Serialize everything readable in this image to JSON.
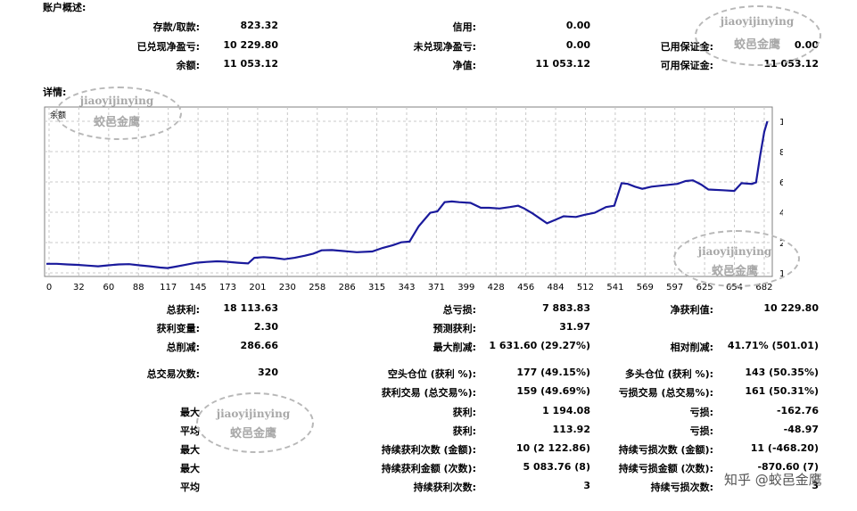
{
  "overview": {
    "title": "账户概述:",
    "rows": [
      [
        {
          "label": "存款/取款:",
          "value": "823.32"
        },
        {
          "label": "信用:",
          "value": "0.00"
        },
        {
          "label": "",
          "value": ""
        }
      ],
      [
        {
          "label": "已兑现净盈亏:",
          "value": "10 229.80"
        },
        {
          "label": "未兑现净盈亏:",
          "value": "0.00"
        },
        {
          "label": "已用保证金:",
          "value": "0.00"
        }
      ],
      [
        {
          "label": "余额:",
          "value": "11 053.12"
        },
        {
          "label": "净值:",
          "value": "11 053.12"
        },
        {
          "label": "可用保证金:",
          "value": "11 053.12"
        }
      ]
    ]
  },
  "details": {
    "title": "详情:"
  },
  "chart_data": {
    "type": "line",
    "legend": "余额",
    "series": [
      {
        "name": "余额",
        "color": "#1a1a9c"
      }
    ],
    "x_ticks": [
      "0",
      "32",
      "60",
      "88",
      "117",
      "145",
      "173",
      "201",
      "230",
      "258",
      "286",
      "315",
      "343",
      "371",
      "399",
      "428",
      "456",
      "484",
      "512",
      "541",
      "569",
      "597",
      "625",
      "654",
      "682"
    ],
    "y_ticks": [
      "10945",
      "8792",
      "6638",
      "4485",
      "2332",
      "179"
    ],
    "ylim": [
      179,
      10945
    ],
    "xlim": [
      0,
      700
    ],
    "points": [
      [
        0,
        823
      ],
      [
        10,
        823
      ],
      [
        20,
        780
      ],
      [
        30,
        750
      ],
      [
        40,
        700
      ],
      [
        50,
        650
      ],
      [
        60,
        720
      ],
      [
        70,
        780
      ],
      [
        80,
        800
      ],
      [
        90,
        720
      ],
      [
        100,
        650
      ],
      [
        110,
        560
      ],
      [
        117,
        520
      ],
      [
        125,
        620
      ],
      [
        135,
        760
      ],
      [
        145,
        900
      ],
      [
        155,
        960
      ],
      [
        165,
        1000
      ],
      [
        173,
        980
      ],
      [
        185,
        900
      ],
      [
        195,
        850
      ],
      [
        201,
        1250
      ],
      [
        210,
        1300
      ],
      [
        220,
        1250
      ],
      [
        230,
        1150
      ],
      [
        240,
        1250
      ],
      [
        250,
        1400
      ],
      [
        258,
        1550
      ],
      [
        266,
        1780
      ],
      [
        276,
        1800
      ],
      [
        286,
        1740
      ],
      [
        300,
        1650
      ],
      [
        315,
        1700
      ],
      [
        325,
        1950
      ],
      [
        335,
        2150
      ],
      [
        343,
        2350
      ],
      [
        351,
        2400
      ],
      [
        360,
        3500
      ],
      [
        371,
        4450
      ],
      [
        378,
        4550
      ],
      [
        385,
        5200
      ],
      [
        392,
        5250
      ],
      [
        399,
        5200
      ],
      [
        410,
        5150
      ],
      [
        420,
        4800
      ],
      [
        428,
        4800
      ],
      [
        438,
        4750
      ],
      [
        448,
        4850
      ],
      [
        456,
        4950
      ],
      [
        462,
        4750
      ],
      [
        470,
        4400
      ],
      [
        478,
        4000
      ],
      [
        484,
        3700
      ],
      [
        492,
        3950
      ],
      [
        500,
        4200
      ],
      [
        512,
        4150
      ],
      [
        520,
        4300
      ],
      [
        530,
        4450
      ],
      [
        541,
        4850
      ],
      [
        549,
        4950
      ],
      [
        556,
        6550
      ],
      [
        562,
        6500
      ],
      [
        569,
        6300
      ],
      [
        576,
        6150
      ],
      [
        585,
        6300
      ],
      [
        597,
        6400
      ],
      [
        610,
        6500
      ],
      [
        618,
        6700
      ],
      [
        625,
        6750
      ],
      [
        633,
        6450
      ],
      [
        640,
        6100
      ],
      [
        654,
        6050
      ],
      [
        665,
        6000
      ],
      [
        672,
        6550
      ],
      [
        682,
        6500
      ],
      [
        686,
        6600
      ],
      [
        690,
        8500
      ],
      [
        694,
        10200
      ],
      [
        697,
        10945
      ]
    ]
  },
  "stats": {
    "rows": [
      [
        {
          "label": "总获利:",
          "value": "18 113.63"
        },
        {
          "label": "总亏损:",
          "value": "7 883.83"
        },
        {
          "label": "净获利值:",
          "value": "10 229.80"
        }
      ],
      [
        {
          "label": "获利变量:",
          "value": "2.30"
        },
        {
          "label": "预测获利:",
          "value": "31.97"
        },
        {
          "label": "",
          "value": ""
        }
      ],
      [
        {
          "label": "总削减:",
          "value": "286.66"
        },
        {
          "label": "最大削减:",
          "value": "1 631.60 (29.27%)"
        },
        {
          "label": "相对削减:",
          "value": "41.71% (501.01)"
        }
      ],
      [
        {
          "label": "总交易次数:",
          "value": "320"
        },
        {
          "label": "空头仓位 (获利 %):",
          "value": "177 (49.15%)"
        },
        {
          "label": "多头仓位 (获利 %):",
          "value": "143 (50.35%)"
        }
      ],
      [
        {
          "label": "",
          "value": ""
        },
        {
          "label": "获利交易 (总交易%):",
          "value": "159 (49.69%)"
        },
        {
          "label": "亏损交易 (总交易%):",
          "value": "161 (50.31%)"
        }
      ],
      [
        {
          "label": "最大",
          "value": ""
        },
        {
          "label": "获利:",
          "value": "1 194.08"
        },
        {
          "label": "亏损:",
          "value": "-162.76"
        }
      ],
      [
        {
          "label": "平均",
          "value": ""
        },
        {
          "label": "获利:",
          "value": "113.92"
        },
        {
          "label": "亏损:",
          "value": "-48.97"
        }
      ],
      [
        {
          "label": "最大",
          "value": ""
        },
        {
          "label": "持续获利次数 (金额):",
          "value": "10 (2 122.86)"
        },
        {
          "label": "持续亏损次数 (金额):",
          "value": "11 (-468.20)"
        }
      ],
      [
        {
          "label": "最大",
          "value": ""
        },
        {
          "label": "持续获利金额 (次数):",
          "value": "5 083.76 (8)"
        },
        {
          "label": "持续亏损金额 (次数):",
          "value": "-870.60 (7)"
        }
      ],
      [
        {
          "label": "平均",
          "value": ""
        },
        {
          "label": "持续获利次数:",
          "value": "3"
        },
        {
          "label": "持续亏损次数:",
          "value": "3"
        }
      ]
    ]
  },
  "watermark": {
    "pinyin": "jiaoyijinying",
    "chinese": "蛟邑金鹰",
    "brand": "知乎 @蛟邑金鹰"
  }
}
